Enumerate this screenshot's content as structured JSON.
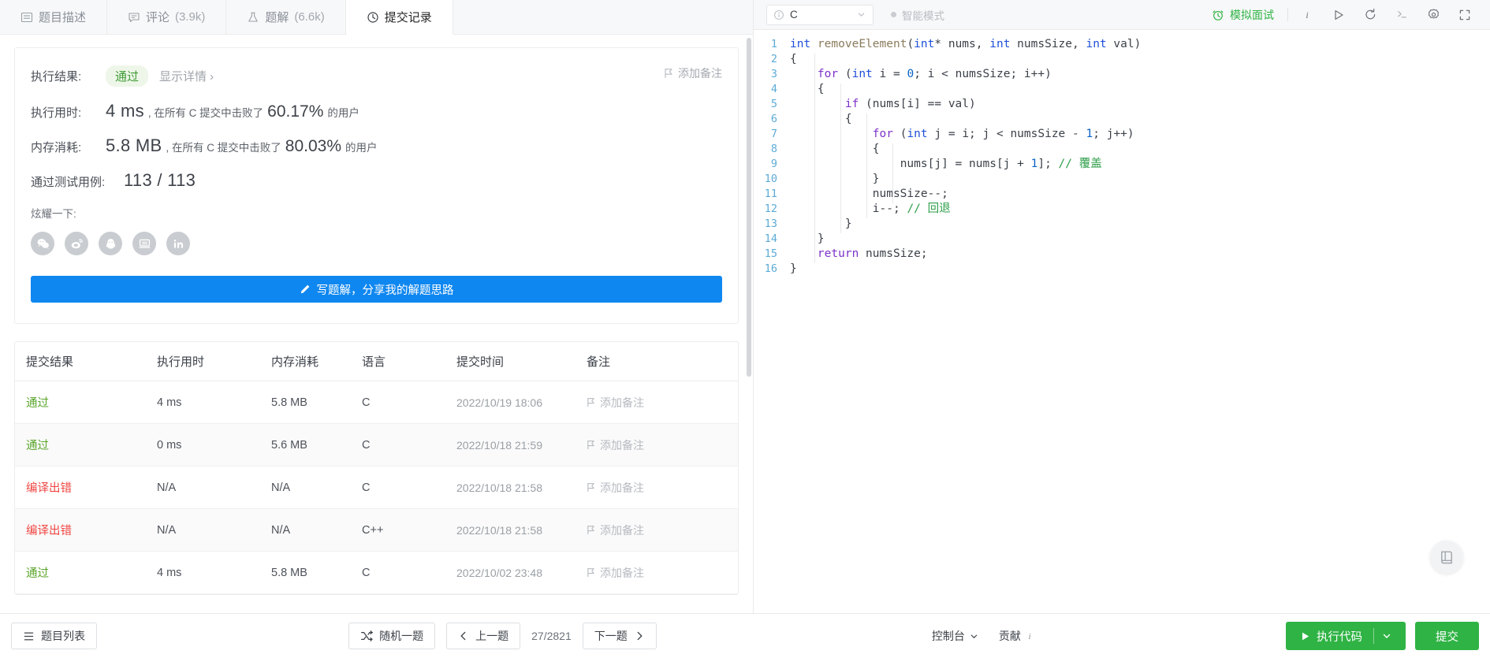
{
  "tabs": [
    {
      "label": "题目描述",
      "icon": "description-icon",
      "count": "",
      "active": false
    },
    {
      "label": "评论",
      "icon": "comment-icon",
      "count": "(3.9k)",
      "active": false
    },
    {
      "label": "题解",
      "icon": "flask-icon",
      "count": "(6.6k)",
      "active": false
    },
    {
      "label": "提交记录",
      "icon": "clock-icon",
      "count": "",
      "active": true
    }
  ],
  "result": {
    "status_label": "执行结果:",
    "status_value": "通过",
    "detail_link": "显示详情 ›",
    "add_note": "添加备注",
    "runtime_label": "执行用时:",
    "runtime_value": "4 ms",
    "runtime_prefix": ", 在所有 C 提交中击败了",
    "runtime_pct": "60.17%",
    "runtime_suffix": "的用户",
    "memory_label": "内存消耗:",
    "memory_value": "5.8 MB",
    "memory_prefix": ", 在所有 C 提交中击败了",
    "memory_pct": "80.03%",
    "memory_suffix": "的用户",
    "cases_label": "通过测试用例:",
    "cases_value": "113 / 113",
    "share_label": "炫耀一下:",
    "share_icons": [
      "wechat-icon",
      "weibo-icon",
      "qq-icon",
      "qzone-icon",
      "linkedin-icon"
    ],
    "solution_button": "写题解，分享我的解题思路"
  },
  "table": {
    "headers": [
      "提交结果",
      "执行用时",
      "内存消耗",
      "语言",
      "提交时间",
      "备注"
    ],
    "rows": [
      {
        "status": "通过",
        "state": "pass",
        "runtime": "4 ms",
        "memory": "5.8 MB",
        "lang": "C",
        "time": "2022/10/19 18:06",
        "note": "添加备注"
      },
      {
        "status": "通过",
        "state": "pass",
        "runtime": "0 ms",
        "memory": "5.6 MB",
        "lang": "C",
        "time": "2022/10/18 21:59",
        "note": "添加备注"
      },
      {
        "status": "编译出错",
        "state": "fail",
        "runtime": "N/A",
        "memory": "N/A",
        "lang": "C",
        "time": "2022/10/18 21:58",
        "note": "添加备注"
      },
      {
        "status": "编译出错",
        "state": "fail",
        "runtime": "N/A",
        "memory": "N/A",
        "lang": "C++",
        "time": "2022/10/18 21:58",
        "note": "添加备注"
      },
      {
        "status": "通过",
        "state": "pass",
        "runtime": "4 ms",
        "memory": "5.8 MB",
        "lang": "C",
        "time": "2022/10/02 23:48",
        "note": "添加备注"
      }
    ]
  },
  "editor": {
    "language": "C",
    "smart_mode": "智能模式",
    "mock_interview": "模拟面试",
    "tools": [
      "info-icon",
      "play-icon",
      "reset-icon",
      "console-icon",
      "settings-icon",
      "fullscreen-icon"
    ],
    "lines": [
      {
        "n": "1",
        "code": "int removeElement(int* nums, int numsSize, int val)"
      },
      {
        "n": "2",
        "code": "{"
      },
      {
        "n": "3",
        "code": "    for (int i = 0; i < numsSize; i++)"
      },
      {
        "n": "4",
        "code": "    {"
      },
      {
        "n": "5",
        "code": "        if (nums[i] == val)"
      },
      {
        "n": "6",
        "code": "        {"
      },
      {
        "n": "7",
        "code": "            for (int j = i; j < numsSize - 1; j++)"
      },
      {
        "n": "8",
        "code": "            {"
      },
      {
        "n": "9",
        "code": "                nums[j] = nums[j + 1]; // 覆盖"
      },
      {
        "n": "10",
        "code": "            }"
      },
      {
        "n": "11",
        "code": "            numsSize--;"
      },
      {
        "n": "12",
        "code": "            i--; // 回退"
      },
      {
        "n": "13",
        "code": "        }"
      },
      {
        "n": "14",
        "code": "    }"
      },
      {
        "n": "15",
        "code": "    return numsSize;"
      },
      {
        "n": "16",
        "code": "}"
      }
    ]
  },
  "bottom": {
    "problem_list": "题目列表",
    "random": "随机一题",
    "prev": "上一题",
    "next": "下一题",
    "pager": "27/2821",
    "console": "控制台",
    "contribution": "贡献",
    "run": "执行代码",
    "submit": "提交"
  },
  "colors": {
    "accent_blue": "#0f87f0",
    "pass_green": "#5aa52b",
    "fail_red": "#ef4743",
    "submit_green": "#2fb344"
  }
}
